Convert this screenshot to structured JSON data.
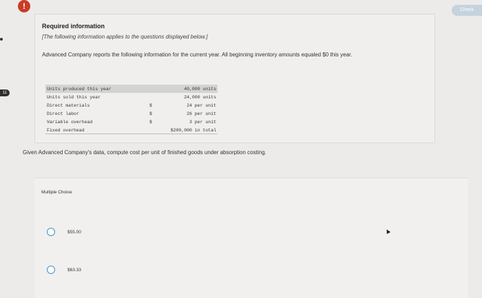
{
  "header": {
    "alert_glyph": "!",
    "check_label": "Check"
  },
  "side_badge": "11",
  "info": {
    "title": "Required information",
    "subtitle": "[The following information applies to the questions displayed below.]",
    "description": "Advanced Company reports the following information for the current year. All beginning inventory amounts equaled $0 this year."
  },
  "table": {
    "rows": [
      {
        "label": "Units produced this year",
        "currency": "",
        "amount": "40,000 units"
      },
      {
        "label": "Units sold this year",
        "currency": "",
        "amount": "24,000 units"
      },
      {
        "label": "Direct materials",
        "currency": "$",
        "amount": "24 per unit"
      },
      {
        "label": "Direct labor",
        "currency": "$",
        "amount": "26 per unit"
      },
      {
        "label": "Variable overhead",
        "currency": "$",
        "amount": "3 per unit"
      },
      {
        "label": "Fixed overhead",
        "currency": "",
        "amount": "$200,000 in total"
      }
    ]
  },
  "question": "Given Advanced Company's data, compute cost per unit of finished goods under absorption costing.",
  "multiple_choice": {
    "label": "Multiple Choice",
    "options": [
      {
        "text": "$55.00"
      },
      {
        "text": "$63.33"
      }
    ]
  }
}
